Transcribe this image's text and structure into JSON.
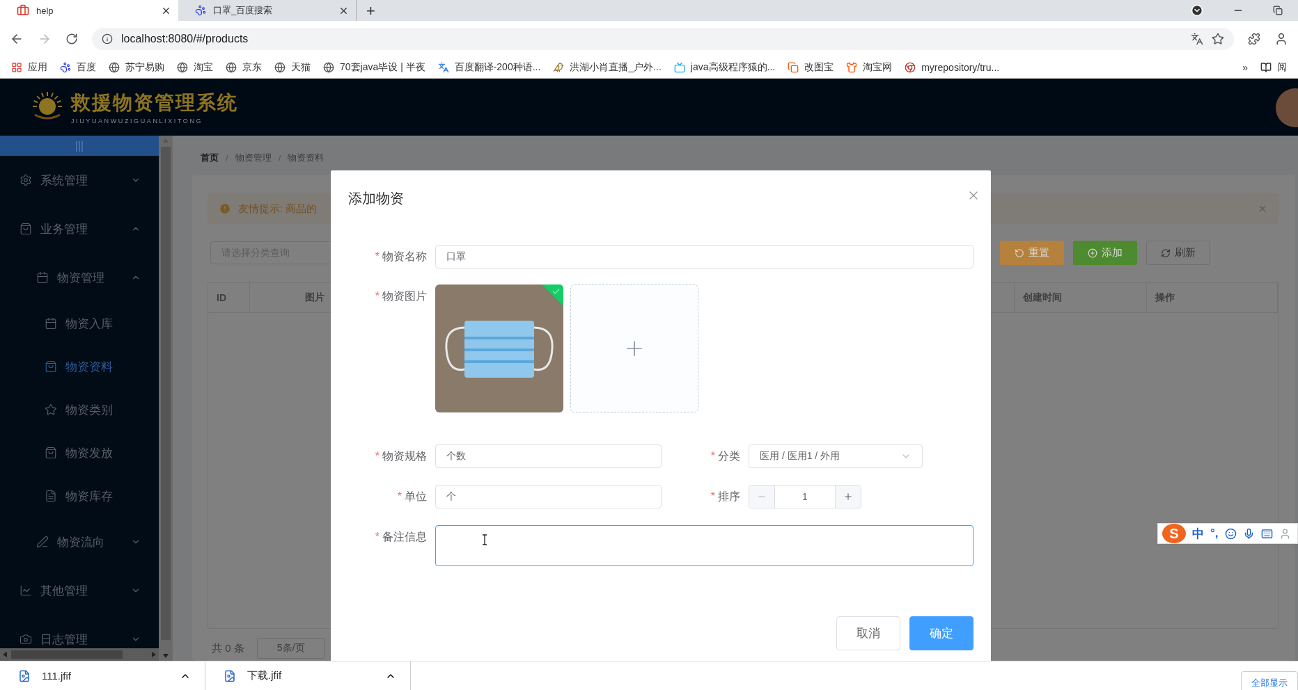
{
  "browser": {
    "tabs": [
      {
        "title": "help",
        "selected": true
      },
      {
        "title": "口罩_百度搜索",
        "selected": false
      }
    ],
    "new_tab": "+",
    "url": "localhost:8080/#/products",
    "bookmarks": [
      "应用",
      "百度",
      "苏宁易购",
      "淘宝",
      "京东",
      "天猫",
      "70套java毕设 | 半夜",
      "百度翻译-200种语...",
      "洪湖小肖直播_户外...",
      "java高级程序猿的...",
      "改图宝",
      "淘宝网",
      "myrepository/tru..."
    ],
    "bookmarks_more": "»",
    "reading_list": "阅"
  },
  "app": {
    "logo_title": "救援物资管理系统",
    "logo_subtitle": "JIUYUANWUZIGUANLIXITONG"
  },
  "sidebar": {
    "toggle": "|||",
    "items": [
      {
        "label": "系统管理",
        "expanded": false
      },
      {
        "label": "业务管理",
        "expanded": true,
        "children": [
          {
            "label": "物资管理",
            "expanded": true,
            "children": [
              {
                "label": "物资入库",
                "selected": false
              },
              {
                "label": "物资资料",
                "selected": true
              },
              {
                "label": "物资类别",
                "selected": false
              },
              {
                "label": "物资发放",
                "selected": false
              },
              {
                "label": "物资库存",
                "selected": false
              }
            ]
          },
          {
            "label": "物资流向",
            "expanded": false
          }
        ]
      },
      {
        "label": "其他管理",
        "expanded": false
      },
      {
        "label": "日志管理",
        "expanded": false
      }
    ]
  },
  "breadcrumb": {
    "separator": "/",
    "items": [
      "首页",
      "物资管理",
      "物资资料"
    ]
  },
  "alert": {
    "text": "友情提示: 商品的"
  },
  "search": {
    "placeholder": "请选择分类查询"
  },
  "toolbar_buttons": [
    {
      "label": "重置",
      "kind": "warning"
    },
    {
      "label": "添加",
      "kind": "success"
    },
    {
      "label": "刷新",
      "kind": "default"
    }
  ],
  "table": {
    "columns": [
      "ID",
      "图片",
      "创建时间",
      "操作"
    ]
  },
  "pagination": {
    "total": "共 0 条",
    "page_size": "5条/页"
  },
  "dialog": {
    "title": "添加物资",
    "required_mark": "*",
    "name": {
      "label": "物资名称",
      "value": "口罩"
    },
    "image": {
      "label": "物资图片",
      "uploaded": true
    },
    "spec": {
      "label": "物资规格",
      "value": "个数"
    },
    "category": {
      "label": "分类",
      "value": "医用 / 医用1 / 外用"
    },
    "unit": {
      "label": "单位",
      "value": "个"
    },
    "sort": {
      "label": "排序",
      "value": "1"
    },
    "remark": {
      "label": "备注信息",
      "focused": true
    },
    "buttons": [
      {
        "label": "取消",
        "kind": "default"
      },
      {
        "label": "确定",
        "kind": "primary"
      }
    ]
  },
  "ime": {
    "logo": "S",
    "mode": "中",
    "punct": "°,"
  },
  "downloads": [
    {
      "name": "111.jfif"
    },
    {
      "name": "下载.jfif"
    }
  ],
  "downloads_show_all": "全部显示"
}
